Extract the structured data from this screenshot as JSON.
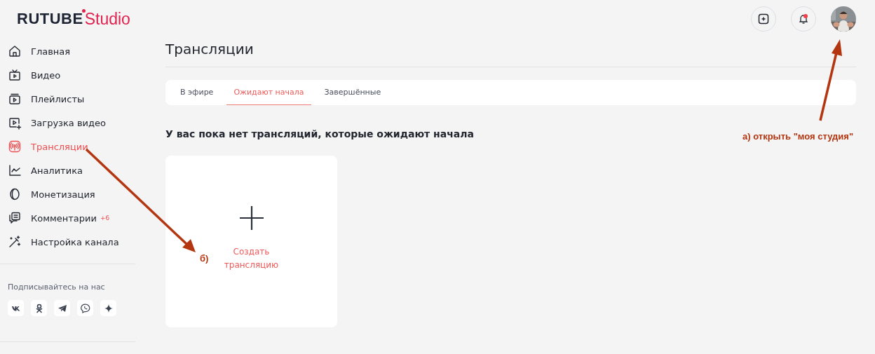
{
  "logo": {
    "brand": "RUTUBE",
    "product": "Studio"
  },
  "header": {
    "buttons": [
      {
        "kind": "add"
      },
      {
        "kind": "bell",
        "unread": true
      }
    ]
  },
  "sidebar": {
    "items": [
      {
        "label": "Главная",
        "selected": false
      },
      {
        "label": "Видео",
        "selected": false
      },
      {
        "label": "Плейлисты",
        "selected": false
      },
      {
        "label": "Загрузка видео",
        "selected": false
      },
      {
        "label": "Трансляции",
        "selected": true
      },
      {
        "label": "Аналитика",
        "selected": false
      },
      {
        "label": "Монетизация",
        "selected": false
      },
      {
        "label": "Комментарии",
        "selected": false,
        "badge": "+6"
      },
      {
        "label": "Настройка канала",
        "selected": false
      }
    ],
    "social_title": "Подписывайтесь на нас",
    "social": [
      {
        "kind": "vk"
      },
      {
        "kind": "ok"
      },
      {
        "kind": "telegram"
      },
      {
        "kind": "viber"
      },
      {
        "kind": "sparkle"
      }
    ]
  },
  "page": {
    "title": "Трансляции",
    "tabs": [
      {
        "label": "В эфире",
        "selected": false
      },
      {
        "label": "Ожидают начала",
        "selected": true
      },
      {
        "label": "Завершённые",
        "selected": false
      }
    ],
    "empty_message": "У вас пока нет трансляций, которые ожидают начала",
    "create_card": {
      "label": "Создать трансляцию"
    }
  },
  "annotations": [
    {
      "text": "а) открыть \"моя студия\""
    },
    {
      "text": "б)"
    }
  ]
}
